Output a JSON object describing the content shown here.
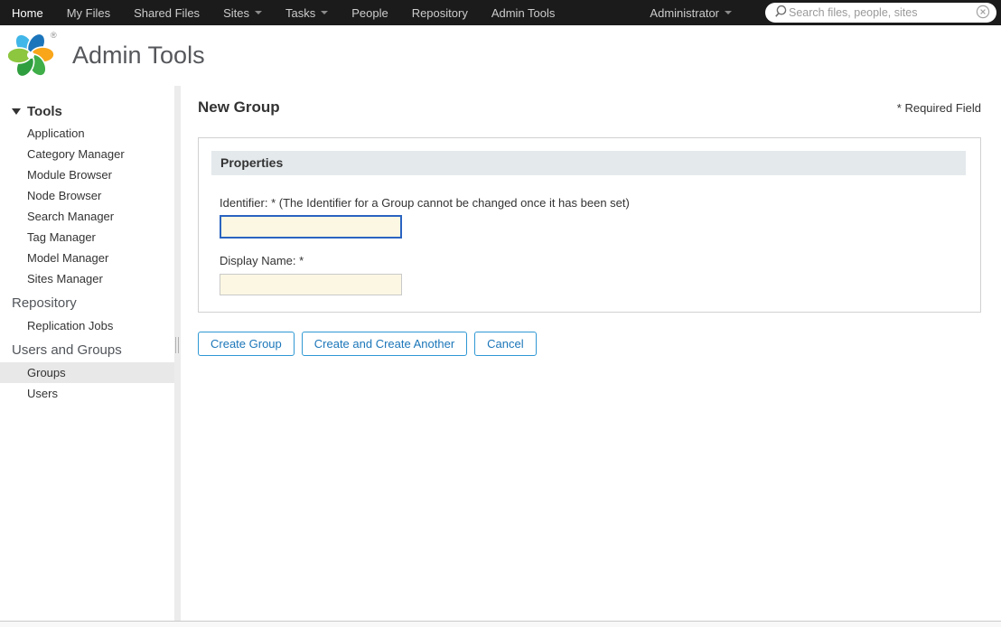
{
  "topnav": {
    "items": [
      {
        "label": "Home"
      },
      {
        "label": "My Files"
      },
      {
        "label": "Shared Files"
      },
      {
        "label": "Sites",
        "caret": true
      },
      {
        "label": "Tasks",
        "caret": true
      },
      {
        "label": "People"
      },
      {
        "label": "Repository"
      },
      {
        "label": "Admin Tools"
      }
    ],
    "user_menu": {
      "label": "Administrator"
    },
    "search": {
      "placeholder": "Search files, people, sites",
      "value": ""
    }
  },
  "header": {
    "title": "Admin Tools",
    "logo_mark": "®"
  },
  "sidebar": {
    "tools": {
      "label": "Tools",
      "items": [
        "Application",
        "Category Manager",
        "Module Browser",
        "Node Browser",
        "Search Manager",
        "Tag Manager",
        "Model Manager",
        "Sites Manager"
      ]
    },
    "repository": {
      "label": "Repository",
      "items": [
        "Replication Jobs"
      ]
    },
    "users_and_groups": {
      "label": "Users and Groups",
      "items": [
        "Groups",
        "Users"
      ],
      "selected": "Groups"
    }
  },
  "main": {
    "page_title": "New Group",
    "required_note": "* Required Field",
    "panel": {
      "header": "Properties",
      "fields": [
        {
          "label": "Identifier: * (The Identifier for a Group cannot be changed once it has been set)",
          "value": "",
          "focused": true
        },
        {
          "label": "Display Name: *",
          "value": "",
          "focused": false
        }
      ]
    },
    "buttons": [
      "Create Group",
      "Create and Create Another",
      "Cancel"
    ]
  },
  "colors": {
    "topbar_bg": "#1b1b1b",
    "topbar_text": "#cccccc",
    "accent_blue": "#2f98d4",
    "button_text_blue": "#1b76b9",
    "focus_border_blue": "#2a64c1",
    "input_bg_cream": "#fbf7e3",
    "panel_header_bg": "#e4e9ec",
    "selected_item_bg": "#e8e8e8",
    "title_gray": "#55575b"
  }
}
